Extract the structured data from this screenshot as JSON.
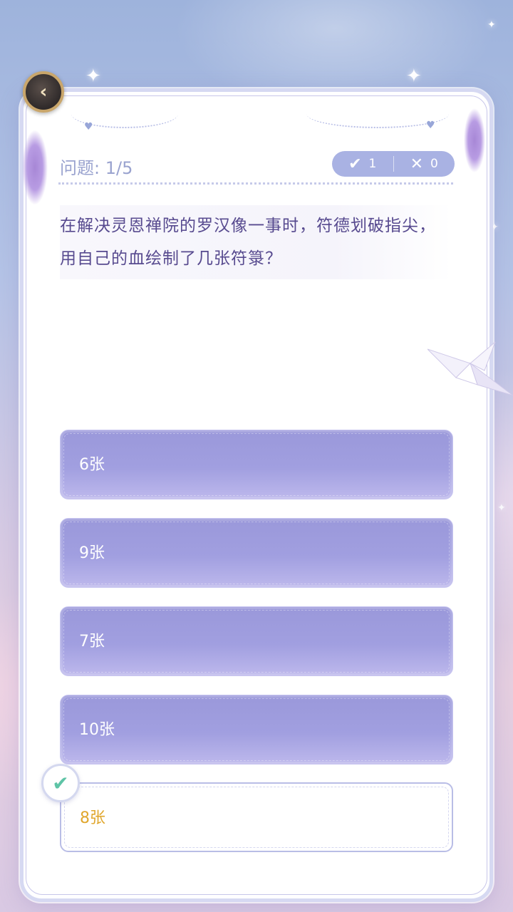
{
  "header": {
    "question_progress": "问题: 1/5",
    "correct_count": "1",
    "wrong_count": "0"
  },
  "icons": {
    "badge": "back-arrow-emblem-icon",
    "correct_score": "check-icon",
    "wrong_score": "cross-icon",
    "answer_mark": "check-icon"
  },
  "question": {
    "text": "在解决灵恩禅院的罗汉像一事时，符德划破指尖，用自己的血绘制了几张符箓？"
  },
  "options": [
    {
      "label": "6张",
      "state": "default"
    },
    {
      "label": "9张",
      "state": "default"
    },
    {
      "label": "7张",
      "state": "default"
    },
    {
      "label": "10张",
      "state": "default"
    },
    {
      "label": "8张",
      "state": "correct"
    }
  ],
  "colors": {
    "option_fill": "#a19fe0",
    "correct_text": "#e0a72e",
    "check_mark": "#5ec4a6",
    "question_text": "#574a8f"
  }
}
